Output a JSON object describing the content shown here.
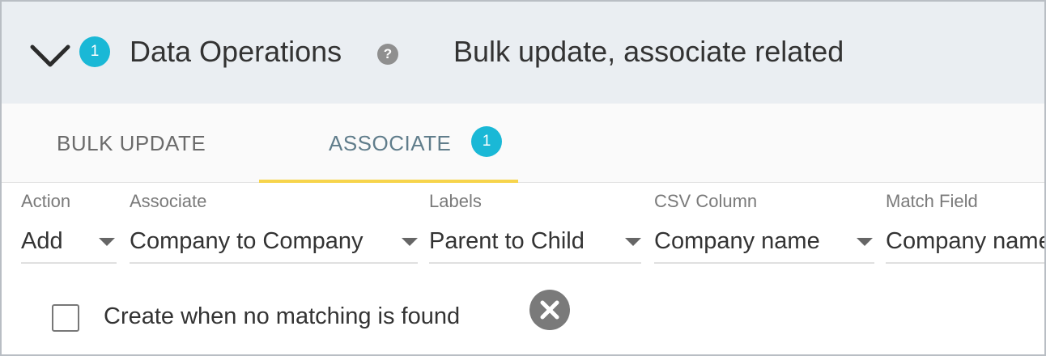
{
  "header": {
    "title": "Data Operations",
    "badge_count": "1",
    "help_icon": "?",
    "description": "Bulk update, associate related"
  },
  "tabs": [
    {
      "label": "BULK UPDATE"
    },
    {
      "label": "ASSOCIATE",
      "badge_count": "1",
      "active": true
    }
  ],
  "fields": {
    "action": {
      "label": "Action",
      "value": "Add"
    },
    "associate": {
      "label": "Associate",
      "value": "Company to Company"
    },
    "labels": {
      "label": "Labels",
      "value": "Parent to Child"
    },
    "csv_column": {
      "label": "CSV Column",
      "value": "Company name"
    },
    "match_field": {
      "label": "Match Field",
      "value": "Company name"
    }
  },
  "options": {
    "create_when_no_match": {
      "label": "Create when no matching is found",
      "checked": false
    }
  },
  "colors": {
    "badge": "#1ab8d6",
    "active_tab_underline": "#f7d44c",
    "header_bg": "#eaeef2"
  }
}
